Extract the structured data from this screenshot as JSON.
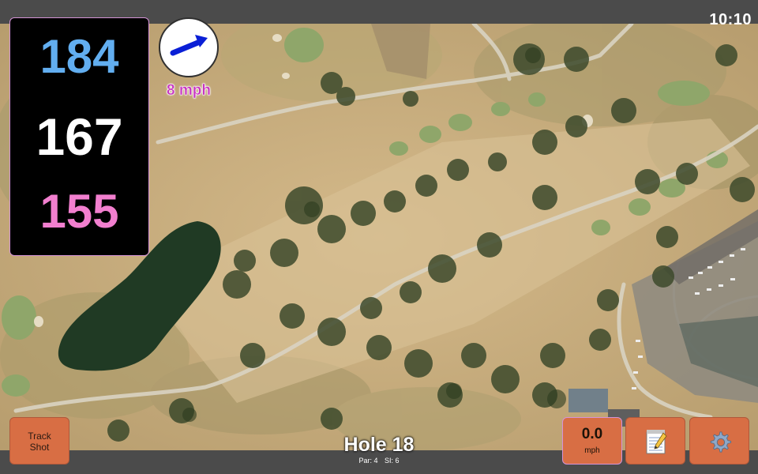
{
  "status_bar": {
    "time": "10:10"
  },
  "distances": {
    "back": "184",
    "middle": "167",
    "front": "155"
  },
  "wind": {
    "speed_label": "8 mph",
    "direction_icon": "arrow-icon"
  },
  "buttons": {
    "track_shot_line1": "Track",
    "track_shot_line2": "Shot",
    "shot_speed_value": "0.0",
    "shot_speed_unit": "mph",
    "notes_icon": "notepad-icon",
    "settings_icon": "gear-icon"
  },
  "hole": {
    "title": "Hole 18",
    "par": "Par: 4",
    "stroke_index": "SI: 6"
  },
  "colors": {
    "back": "#62aef0",
    "middle": "#ffffff",
    "front": "#f27fcf",
    "wind_label": "#c735c0",
    "button": "#d86e44",
    "panel_border": "#d493d6"
  }
}
